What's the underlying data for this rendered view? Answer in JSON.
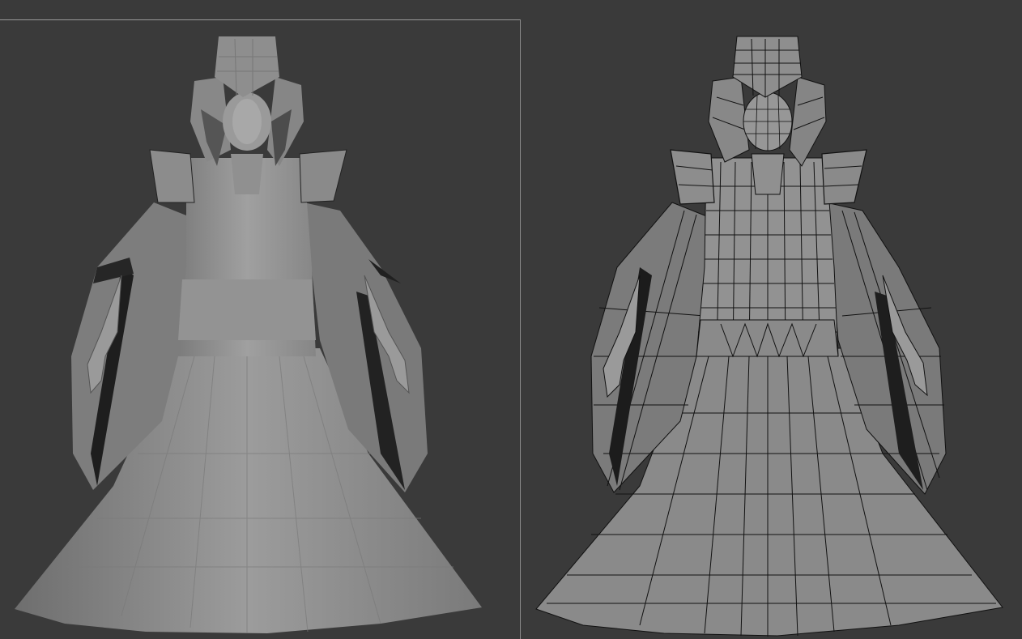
{
  "viewports": [
    {
      "id": "left",
      "shading": "smooth-shaded"
    },
    {
      "id": "right",
      "shading": "edged-faces"
    }
  ],
  "colors": {
    "background": "#3a3a3a",
    "mesh_light": "#a8a8a8",
    "mesh_mid": "#8c8c8c",
    "mesh_dark": "#5e5e5e",
    "mesh_shadow": "#1e1e1e",
    "wire": "#111111",
    "border": "#9a9a9a"
  }
}
